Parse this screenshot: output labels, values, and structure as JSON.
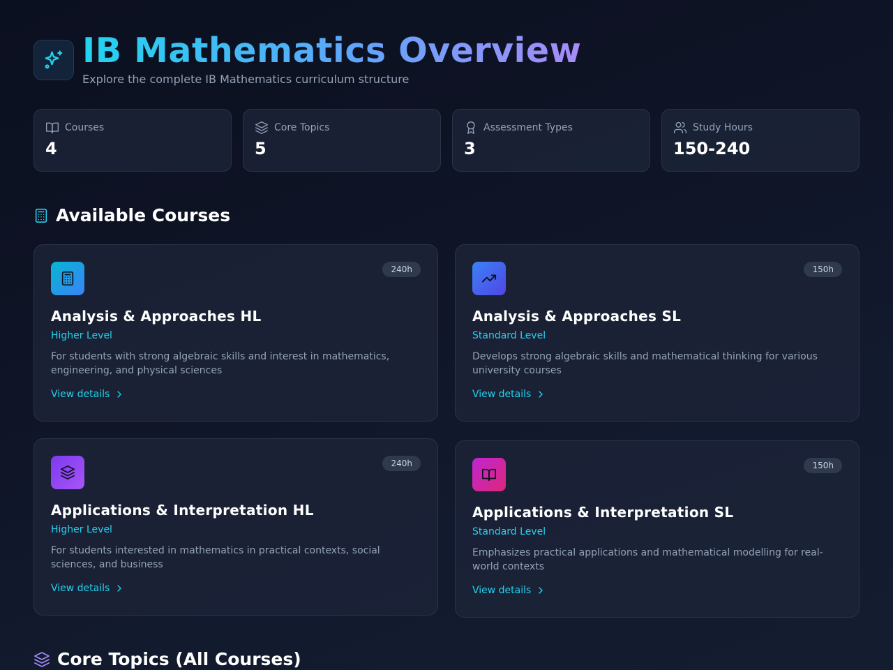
{
  "header": {
    "title": "IB Mathematics Overview",
    "subtitle": "Explore the complete IB Mathematics curriculum structure",
    "logo_icon": "sparkles-icon"
  },
  "stats": [
    {
      "label": "Courses",
      "value": "4",
      "icon": "book-open-icon"
    },
    {
      "label": "Core Topics",
      "value": "5",
      "icon": "layers-icon"
    },
    {
      "label": "Assessment Types",
      "value": "3",
      "icon": "award-icon"
    },
    {
      "label": "Study Hours",
      "value": "150-240",
      "icon": "users-icon"
    }
  ],
  "sections": {
    "courses_title": "Available Courses",
    "topics_title": "Core Topics (All Courses)"
  },
  "courses": [
    {
      "title": "Analysis & Approaches HL",
      "level": "Higher Level",
      "hours": "240h",
      "description": "For students with strong algebraic skills and interest in mathematics, engineering, and physical sciences",
      "link": "View details",
      "icon": "calculator-icon"
    },
    {
      "title": "Analysis & Approaches SL",
      "level": "Standard Level",
      "hours": "150h",
      "description": "Develops strong algebraic skills and mathematical thinking for various university courses",
      "link": "View details",
      "icon": "trending-up-icon"
    },
    {
      "title": "Applications & Interpretation HL",
      "level": "Higher Level",
      "hours": "240h",
      "description": "For students interested in mathematics in practical contexts, social sciences, and business",
      "link": "View details",
      "icon": "layers-icon"
    },
    {
      "title": "Applications & Interpretation SL",
      "level": "Standard Level",
      "hours": "150h",
      "description": "Emphasizes practical applications and mathematical modelling for real-world contexts",
      "link": "View details",
      "icon": "book-open-icon"
    }
  ],
  "colors": {
    "accent": "#22d3ee",
    "background": "#0f1426",
    "card": "#1c2337",
    "muted": "#94a3b8"
  }
}
